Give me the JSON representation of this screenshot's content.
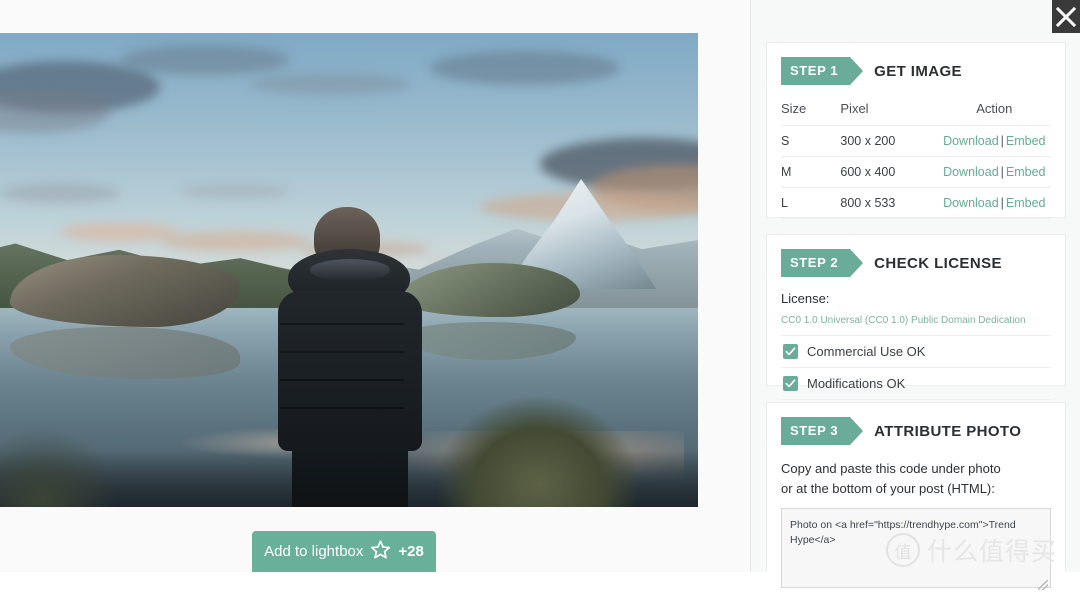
{
  "close_button": {
    "icon": "close-icon",
    "label": "Close"
  },
  "photo": {
    "alt": "Man in dark puffer jacket standing at a mountain lake facing snowy peak",
    "lightbox_button": {
      "label": "Add to lightbox",
      "icon": "star-icon",
      "count": "+28"
    }
  },
  "panel": {
    "steps": [
      {
        "badge": "STEP 1",
        "title": "GET IMAGE",
        "table": {
          "headers": [
            "Size",
            "Pixel",
            "Action"
          ],
          "rows": [
            {
              "size": "S",
              "pixel": "300 x 200",
              "download": "Download",
              "separator": "|",
              "embed": "Embed"
            },
            {
              "size": "M",
              "pixel": "600 x 400",
              "download": "Download",
              "separator": "|",
              "embed": "Embed"
            },
            {
              "size": "L",
              "pixel": "800 x 533",
              "download": "Download",
              "separator": "|",
              "embed": "Embed"
            }
          ]
        }
      },
      {
        "badge": "STEP 2",
        "title": "CHECK LICENSE",
        "license_label": "License:",
        "license_link": "CC0 1.0 Universal (CC0 1.0) Public Domain Dedication",
        "checks": [
          {
            "label": "Commercial Use OK",
            "checked": true
          },
          {
            "label": "Modifications OK",
            "checked": true
          }
        ]
      },
      {
        "badge": "STEP 3",
        "title": "ATTRIBUTE PHOTO",
        "instruction_line1": "Copy and paste this code under photo",
        "instruction_line2": "or at the bottom of your post (HTML):",
        "embed_code": "Photo on <a href=\"https://trendhype.com\">Trend Hype</a>"
      }
    ]
  },
  "watermark": {
    "mark": "值",
    "text": "什么值得买"
  },
  "colors": {
    "accent": "#6aab99",
    "button": "#68b09a",
    "link": "#66ab96",
    "panel_bg": "#f7f8f8",
    "close_bg": "#3a3a3a"
  }
}
